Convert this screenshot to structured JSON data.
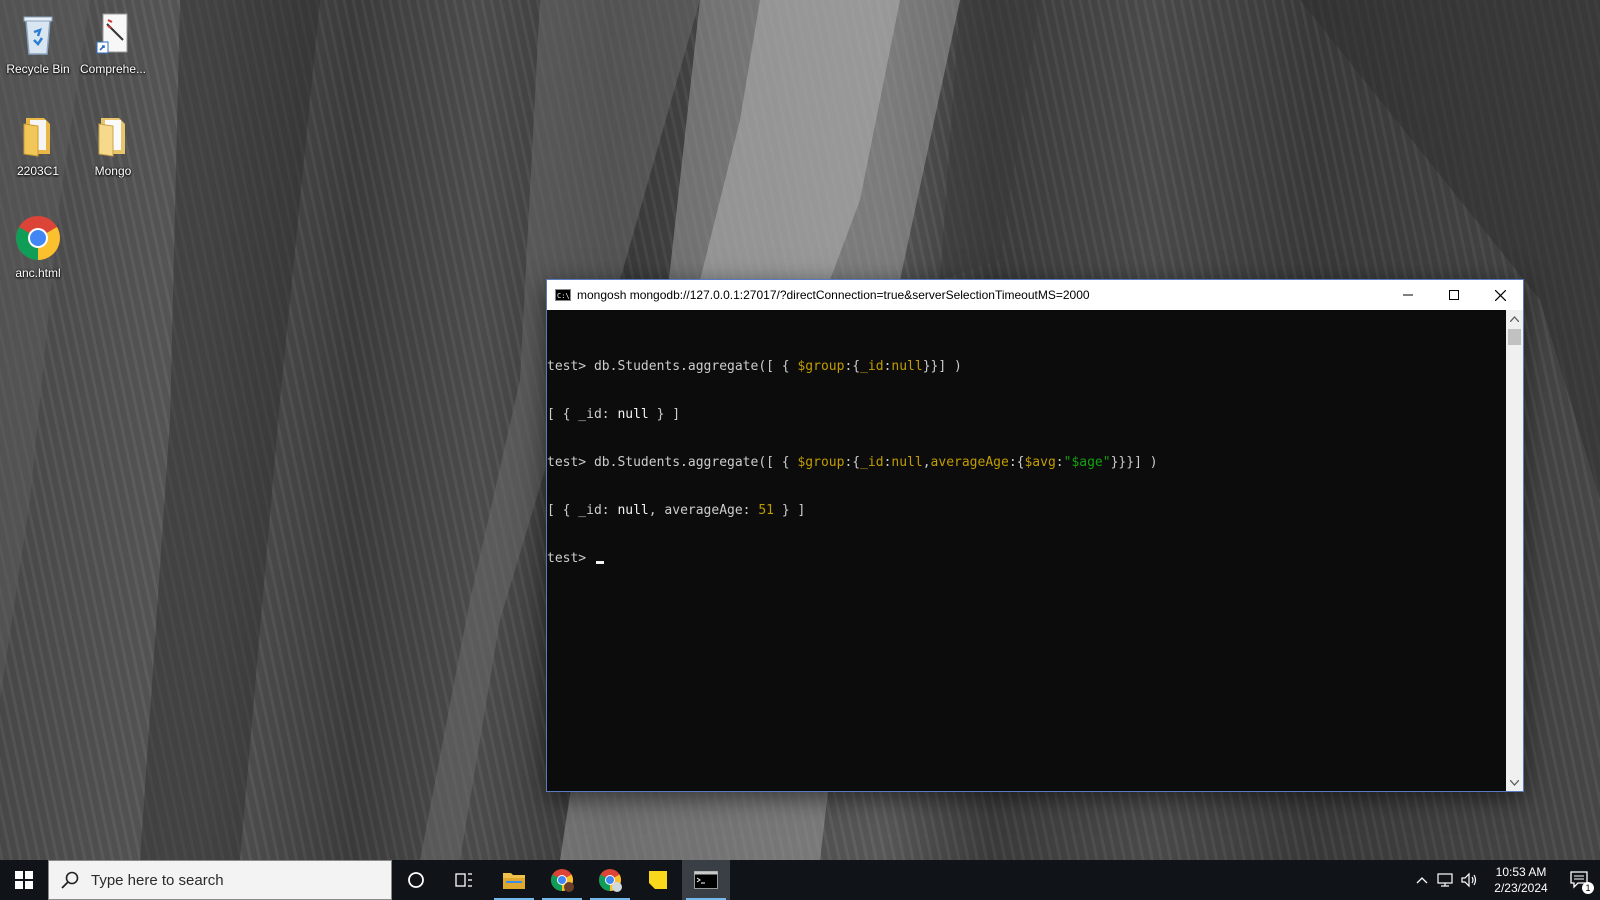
{
  "desktop": {
    "icons": [
      {
        "label": "Recycle Bin",
        "icon": "recycle-bin-icon"
      },
      {
        "label": "Comprehe...",
        "icon": "shortcut-document-icon"
      },
      {
        "label": "2203C1",
        "icon": "folder-icon"
      },
      {
        "label": "Mongo",
        "icon": "folder-icon"
      },
      {
        "label": "anc.html",
        "icon": "chrome-icon"
      }
    ]
  },
  "terminal": {
    "title": "mongosh mongodb://127.0.0.1:27017/?directConnection=true&serverSelectionTimeoutMS=2000",
    "lines": {
      "l1": {
        "prompt": "test> ",
        "cmd_a": "db.Students.aggregate([ { ",
        "cmd_b": "$group",
        "cmd_c": ":{",
        "cmd_d": "_id",
        "cmd_e": ":",
        "cmd_f": "null",
        "cmd_g": "}}] )"
      },
      "l2": {
        "a": "[ { _id: ",
        "b": "null",
        "c": " } ]"
      },
      "l3": {
        "prompt": "test> ",
        "cmd_a": "db.Students.aggregate([ { ",
        "cmd_b": "$group",
        "cmd_c": ":{",
        "cmd_d": "_id",
        "cmd_e": ":",
        "cmd_f": "null",
        "cmd_g": ",",
        "cmd_h": "averageAge",
        "cmd_i": ":{",
        "cmd_j": "$avg",
        "cmd_k": ":",
        "cmd_l": "\"$age\"",
        "cmd_m": "}}}] )"
      },
      "l4": {
        "a": "[ { _id: ",
        "b": "null",
        "c": ", averageAge: ",
        "d": "51",
        "e": " } ]"
      },
      "l5": {
        "prompt": "test> "
      }
    },
    "colors": {
      "background": "#0c0c0c",
      "text": "#cccccc",
      "keyword": "#c19c00",
      "string": "#13a10e"
    }
  },
  "taskbar": {
    "search_placeholder": "Type here to search",
    "apps": [
      {
        "name": "file-explorer",
        "icon": "folder-icon",
        "running": true
      },
      {
        "name": "chrome-profile-a",
        "icon": "chrome-icon",
        "running": true
      },
      {
        "name": "chrome",
        "icon": "chrome-icon",
        "running": true
      },
      {
        "name": "sticky-notes",
        "icon": "sticky-notes-icon",
        "running": false
      },
      {
        "name": "command-prompt",
        "icon": "terminal-icon",
        "running": true
      }
    ],
    "clock": {
      "time": "10:53 AM",
      "date": "2/23/2024"
    },
    "notifications_count": "1"
  }
}
